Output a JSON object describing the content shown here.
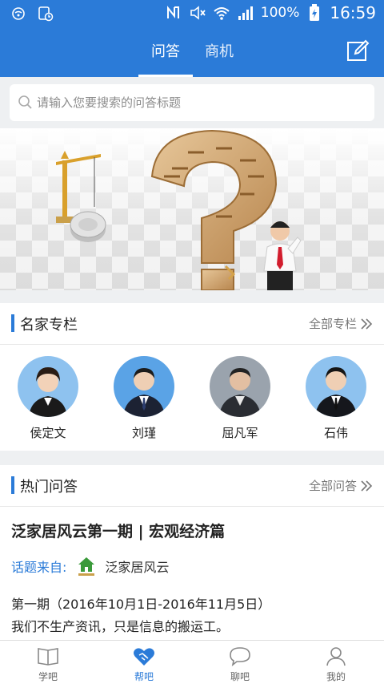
{
  "statusbar": {
    "battery": "100%",
    "time": "16:59"
  },
  "header": {
    "tabs": [
      {
        "label": "问答"
      },
      {
        "label": "商机"
      }
    ]
  },
  "search": {
    "placeholder": "请输入您要搜索的问答标题"
  },
  "experts_section": {
    "title": "名家专栏",
    "more": "全部专栏",
    "experts": [
      {
        "name": "侯定文"
      },
      {
        "name": "刘瑾"
      },
      {
        "name": "屈凡军"
      },
      {
        "name": "石伟"
      }
    ]
  },
  "hot_section": {
    "title": "热门问答",
    "more": "全部问答",
    "question": {
      "title": "泛家居风云第一期 | 宏观经济篇",
      "topic_label": "话题来自:",
      "topic_name": "泛家居风云",
      "line1": "第一期（2016年10月1日-2016年11月5日）",
      "line2": "我们不生产资讯，只是信息的搬运工。"
    }
  },
  "bottomnav": {
    "items": [
      {
        "label": "学吧",
        "icon": "book-icon"
      },
      {
        "label": "帮吧",
        "icon": "handshake-icon"
      },
      {
        "label": "聊吧",
        "icon": "chat-bubble-icon"
      },
      {
        "label": "我的",
        "icon": "person-icon"
      }
    ],
    "active": "帮吧"
  },
  "colors": {
    "primary": "#2b7bd8",
    "background": "#eef0f2"
  }
}
